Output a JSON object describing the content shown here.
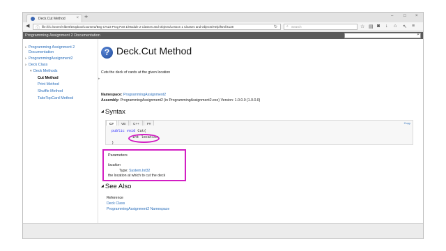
{
  "browser": {
    "tab_title": "Deck.Cut Method",
    "tab_close": "×",
    "new_tab": "+",
    "window_controls": [
      "–",
      "□",
      "×"
    ],
    "url": "file:///C:/Users/Albert/Dropbox/Coursera/Beg C%23 Prog Part 1/Module 2 Classes and Objects/Lesson 1 Classes and Objects/Help/html/4138",
    "search_placeholder": "Search"
  },
  "doc": {
    "header_title": "Programming Assignment 2 Documentation",
    "toc": [
      {
        "label": "Programming Assignment 2",
        "label2": "Documentation"
      },
      {
        "label": "ProgrammingAssignment2"
      },
      {
        "label": "Deck Class"
      },
      {
        "label": "Deck Methods"
      },
      {
        "label": "Cut Method"
      },
      {
        "label": "Print Method"
      },
      {
        "label": "Shuffle Method"
      },
      {
        "label": "TakeTopCard Method"
      }
    ],
    "title": "Deck.Cut Method",
    "summary": "Cuts the deck of cards at the given location",
    "namespace_label": "Namespace:",
    "namespace_value": "ProgrammingAssignment2",
    "assembly_label": "Assembly:",
    "assembly_value": "ProgrammingAssignment2 (in ProgrammingAssignment2.exe) Version: 1.0.0.0 (1.0.0.0)",
    "syntax_heading": "Syntax",
    "lang_tabs": [
      "C#",
      "VB",
      "C++",
      "F#"
    ],
    "copy_label": "Copy",
    "code_line1_kw": "public void",
    "code_line1_rest": " Cut(",
    "code_line2": "int location",
    "code_line3": ")",
    "params_heading": "Parameters",
    "param_name": "location",
    "param_type_label": "Type: ",
    "param_type_value": "System.Int32",
    "param_desc": "the location at which to cut the deck",
    "see_also_heading": "See Also",
    "reference_label": "Reference",
    "links": [
      "Deck Class",
      "ProgrammingAssignment2 Namespace"
    ]
  },
  "colors": {
    "highlight": "#d21ec3",
    "link": "#2a6ebb",
    "header_bar": "#5a5a5a"
  }
}
